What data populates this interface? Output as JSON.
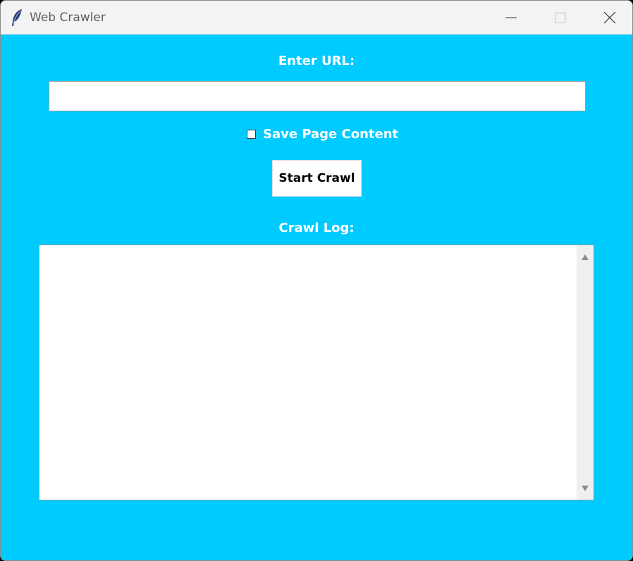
{
  "window": {
    "title": "Web Crawler",
    "icons": {
      "app": "feather-icon",
      "minimize": "minimize-icon",
      "maximize": "maximize-icon",
      "close": "close-icon"
    }
  },
  "form": {
    "url_label": "Enter URL:",
    "url_value": "",
    "url_placeholder": "",
    "save_checkbox_label": "Save Page Content",
    "save_checkbox_checked": false,
    "start_button_label": "Start Crawl",
    "log_label": "Crawl Log:",
    "log_text": ""
  },
  "colors": {
    "background": "#00cbff",
    "label_text": "#ffffff",
    "titlebar": "#f3f3f3"
  }
}
